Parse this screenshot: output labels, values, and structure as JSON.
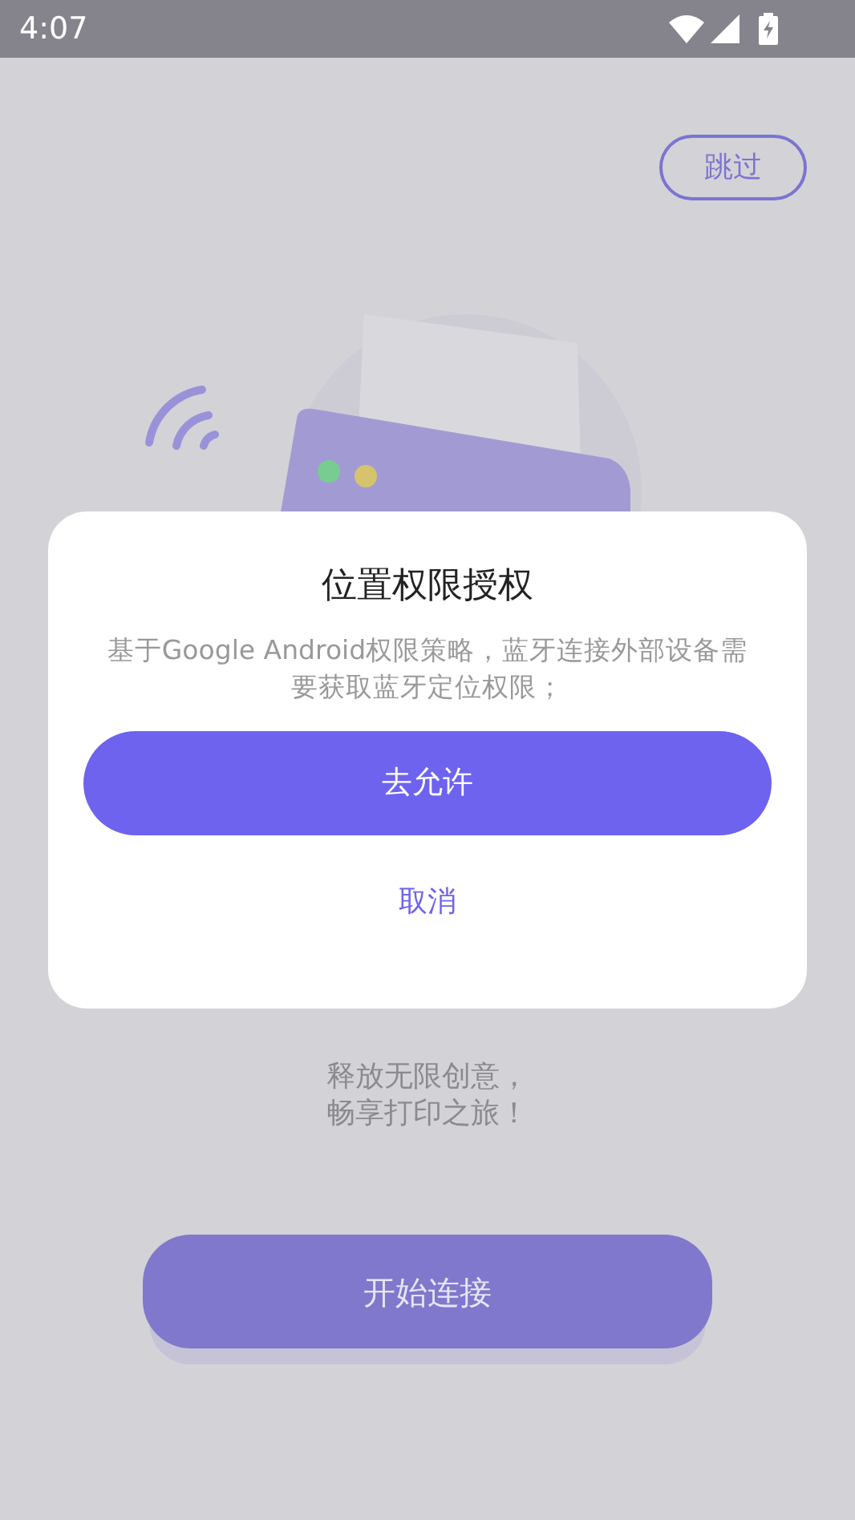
{
  "status_bar": {
    "time": "4:07"
  },
  "skip_button": {
    "label": "跳过"
  },
  "tagline": [
    "释放无限创意，",
    "畅享打印之旅！"
  ],
  "start_button": {
    "label": "开始连接"
  },
  "dialog": {
    "title": "位置权限授权",
    "message": "基于Google Android权限策略，蓝牙连接外部设备需要获取蓝牙定位权限；",
    "confirm": "去允许",
    "cancel": "取消"
  }
}
